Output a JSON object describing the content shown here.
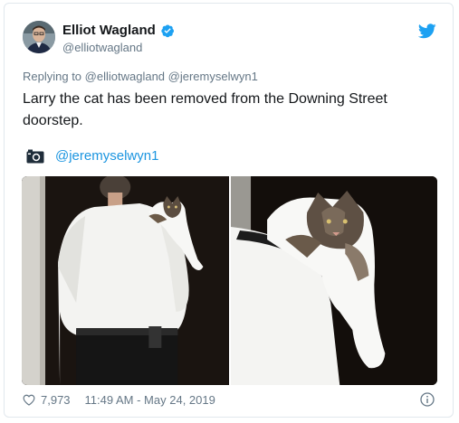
{
  "author": {
    "name": "Elliot Wagland",
    "handle": "@elliotwagland",
    "verified": true
  },
  "reply": {
    "prefix": "Replying to",
    "mentions": "@elliotwagland @jeremyselwyn1"
  },
  "tweet": {
    "text": "Larry the cat has been removed from the Downing Street doorstep."
  },
  "media": {
    "credit_icon": "camera-icon",
    "credit": "@jeremyselwyn1",
    "photo_count": 2
  },
  "footer": {
    "likes": "7,973",
    "timestamp": "11:49 AM - May 24, 2019"
  },
  "colors": {
    "twitter_blue": "#1da1f2",
    "link_blue": "#1b95e0",
    "muted": "#657786",
    "border": "#e1e8ed"
  }
}
